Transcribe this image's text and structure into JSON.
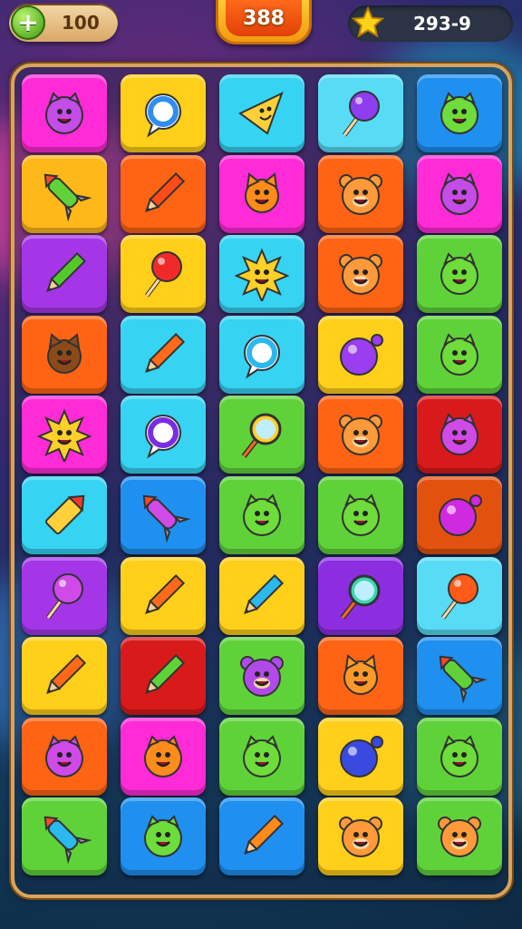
{
  "hud": {
    "coins": "100",
    "coins_add_icon": "plus-icon",
    "score": "388",
    "stars": "293-9",
    "stars_icon": "star-icon"
  },
  "board": {
    "rows": [
      [
        [
          "#ff2bd6",
          "monster",
          "#c34de6"
        ],
        [
          "#ffcf1a",
          "bubble",
          "#2f8ff0"
        ],
        [
          "#36d3f2",
          "nacho",
          "#ffd03a"
        ],
        [
          "#58dbf4",
          "lollipop",
          "#8e3ef0"
        ],
        [
          "#1f8ff0",
          "monster",
          "#6edc3a"
        ]
      ],
      [
        [
          "#ffb81a",
          "rocket",
          "#5fd23a"
        ],
        [
          "#ff6414",
          "pencil",
          "#ff4a1a"
        ],
        [
          "#ff2bd6",
          "cat",
          "#ff8c1a"
        ],
        [
          "#ff6414",
          "bear",
          "#ff9a3a"
        ],
        [
          "#ff2bd6",
          "monster",
          "#c34de6"
        ]
      ],
      [
        [
          "#a436e8",
          "pencil",
          "#54c72a"
        ],
        [
          "#ffcf1a",
          "lollipop",
          "#f02a2a"
        ],
        [
          "#36d3f2",
          "sun",
          "#ffcf2a"
        ],
        [
          "#ff6414",
          "bear",
          "#ff9a3a"
        ],
        [
          "#5fd23a",
          "monster",
          "#6edc3a"
        ]
      ],
      [
        [
          "#ff6414",
          "cat",
          "#8a4a1a"
        ],
        [
          "#36d3f2",
          "pencil",
          "#ff6a1a"
        ],
        [
          "#36d3f2",
          "bubble",
          "#2ab8ee"
        ],
        [
          "#ffcf1a",
          "bomb",
          "#9a3ef0"
        ],
        [
          "#5fd23a",
          "monster",
          "#6edc3a"
        ]
      ],
      [
        [
          "#ff2bd6",
          "sun",
          "#ffcf2a"
        ],
        [
          "#36d3f2",
          "bubble",
          "#7a2ee0"
        ],
        [
          "#5fd23a",
          "magnifier",
          "#ffcf2a"
        ],
        [
          "#ff6414",
          "bear",
          "#ff9a3a"
        ],
        [
          "#d91a1a",
          "monster",
          "#d04ae8"
        ]
      ],
      [
        [
          "#36d3f2",
          "crayon",
          "#ffd03a"
        ],
        [
          "#1f8ff0",
          "rocket",
          "#d04ae8"
        ],
        [
          "#5fd23a",
          "monster",
          "#6edc3a"
        ],
        [
          "#5fd23a",
          "monster",
          "#6edc3a"
        ],
        [
          "#e2520e",
          "bomb",
          "#d02ae0"
        ]
      ],
      [
        [
          "#a436e8",
          "lollipop",
          "#d04ae8"
        ],
        [
          "#ffcf1a",
          "pencil",
          "#ff6a1a"
        ],
        [
          "#ffcf1a",
          "pencil",
          "#2ab8ee"
        ],
        [
          "#8c2ee0",
          "magnifier",
          "#3ad6b0"
        ],
        [
          "#58dbf4",
          "lollipop",
          "#ff5a1a"
        ]
      ],
      [
        [
          "#ffcf1a",
          "pencil",
          "#ff6a1a"
        ],
        [
          "#d91a1a",
          "pencil",
          "#5fd23a"
        ],
        [
          "#5fd23a",
          "bear",
          "#b24ae8"
        ],
        [
          "#ff6414",
          "cat",
          "#ff9a2a"
        ],
        [
          "#1f8ff0",
          "rocket",
          "#5fd23a"
        ]
      ],
      [
        [
          "#ff6414",
          "monster",
          "#d04ae8"
        ],
        [
          "#ff2bd6",
          "monster",
          "#ff8c1a"
        ],
        [
          "#5fd23a",
          "monster",
          "#6edc3a"
        ],
        [
          "#ffcf1a",
          "bomb",
          "#3a4ae0"
        ],
        [
          "#5fd23a",
          "monster",
          "#6edc3a"
        ]
      ],
      [
        [
          "#5fd23a",
          "rocket",
          "#2ab8ee"
        ],
        [
          "#1f8ff0",
          "monster",
          "#6edc3a"
        ],
        [
          "#1f8ff0",
          "pencil",
          "#ff8a1a"
        ],
        [
          "#ffcf1a",
          "bear",
          "#ff9a3a"
        ],
        [
          "#5fd23a",
          "bear",
          "#ff9a3a"
        ]
      ]
    ]
  }
}
